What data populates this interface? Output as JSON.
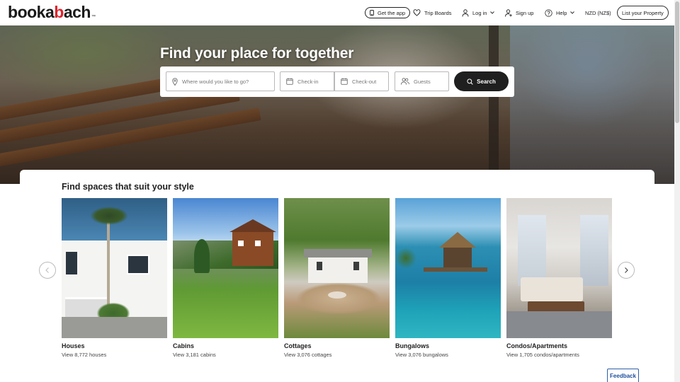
{
  "header": {
    "logo": {
      "part1": "b",
      "part2": "oo",
      "part3": "ka",
      "part4": "b",
      "part5": "ach",
      "tm": "™"
    },
    "get_app": "Get the app",
    "trip_boards": "Trip Boards",
    "log_in": "Log in",
    "sign_up": "Sign up",
    "help": "Help",
    "currency": "NZD (NZ$)",
    "list_property": "List your Property"
  },
  "hero": {
    "title": "Find your place for together",
    "search": {
      "where_placeholder": "Where would you like to go?",
      "check_in": "Check-in",
      "check_out": "Check-out",
      "guests": "Guests",
      "button": "Search"
    }
  },
  "section": {
    "title": "Find spaces that suit your style",
    "cards": [
      {
        "title": "Houses",
        "sub": "View 8,772 houses"
      },
      {
        "title": "Cabins",
        "sub": "View 3,181 cabins"
      },
      {
        "title": "Cottages",
        "sub": "View 3,076 cottages"
      },
      {
        "title": "Bungalows",
        "sub": "View 3,076 bungalows"
      },
      {
        "title": "Condos/Apartments",
        "sub": "View 1,705 condos/apartments"
      }
    ]
  },
  "feedback": "Feedback",
  "colors": {
    "accent_red": "#e0242c",
    "search_button": "#1f1f1f",
    "feedback_blue": "#1c4f9c"
  }
}
